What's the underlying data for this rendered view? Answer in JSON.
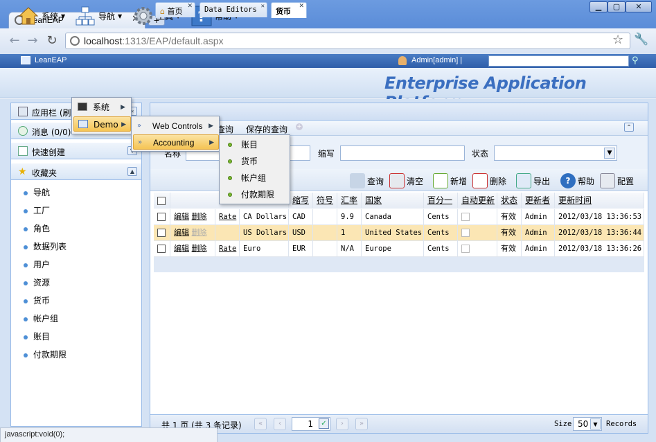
{
  "browser": {
    "tab_title": "LeanEAP",
    "url_host": "localhost",
    "url_rest": ":1313/EAP/default.aspx"
  },
  "app": {
    "name": "LeanEAP",
    "user": "Admin[admin]  |",
    "platform_title": "Enterprise Application Platform"
  },
  "toolbar": {
    "system": "系统",
    "nav": "导航",
    "tools": "工具",
    "help": "帮助"
  },
  "left": {
    "apps_label": "应用栏 (刷新)",
    "messages_label": "消息 (0/0)",
    "quick_create": "快速创建",
    "favorites": "收藏夹",
    "items": [
      "导航",
      "工厂",
      "角色",
      "数据列表",
      "用户",
      "资源",
      "货币",
      "帐户组",
      "账目",
      "付款期限"
    ]
  },
  "tabs": [
    {
      "label": "首页"
    },
    {
      "label": "Data Editors"
    },
    {
      "label": "货币"
    }
  ],
  "subbar": {
    "query": "查询",
    "saved": "保存的查询"
  },
  "filter": {
    "name": "名称",
    "abbr": "缩写",
    "status": "状态"
  },
  "actions": {
    "query": "查询",
    "clear": "清空",
    "add": "新增",
    "delete": "删除",
    "export": "导出",
    "help": "帮助",
    "config": "配置"
  },
  "grid": {
    "headers": [
      "缩写",
      "符号",
      "汇率",
      "国家",
      "百分一",
      "自动更新",
      "状态",
      "更新者",
      "更新时间"
    ],
    "rows": [
      {
        "edit": "编辑",
        "del": "删除",
        "rate": "Rate",
        "name": "CA Dollars",
        "abbr": "CAD",
        "symbol": "",
        "xrate": "9.9",
        "country": "Canada",
        "cent": "Cents",
        "status": "有效",
        "updater": "Admin",
        "time": "2012/03/18 13:36:53"
      },
      {
        "edit": "编辑",
        "del": "删除",
        "rate": "",
        "name": "US Dollars",
        "abbr": "USD",
        "symbol": "",
        "xrate": "1",
        "country": "United States",
        "cent": "Cents",
        "status": "有效",
        "updater": "Admin",
        "time": "2012/03/18 13:36:44"
      },
      {
        "edit": "编辑",
        "del": "删除",
        "rate": "Rate",
        "name": "Euro",
        "abbr": "EUR",
        "symbol": "",
        "xrate": "N/A",
        "country": "Europe",
        "cent": "Cents",
        "status": "有效",
        "updater": "Admin",
        "time": "2012/03/18 13:36:26"
      }
    ]
  },
  "pager": {
    "summary": "共 1 页 (共 3 条记录)",
    "page": "1",
    "size_label": "Size",
    "size": "50",
    "records": "Records"
  },
  "menus": {
    "level1": [
      "系统",
      "Demo"
    ],
    "level2": [
      "Web Controls",
      "Accounting"
    ],
    "level3": [
      "账目",
      "货币",
      "帐户组",
      "付款期限"
    ]
  },
  "status_text": "javascript:void(0);"
}
